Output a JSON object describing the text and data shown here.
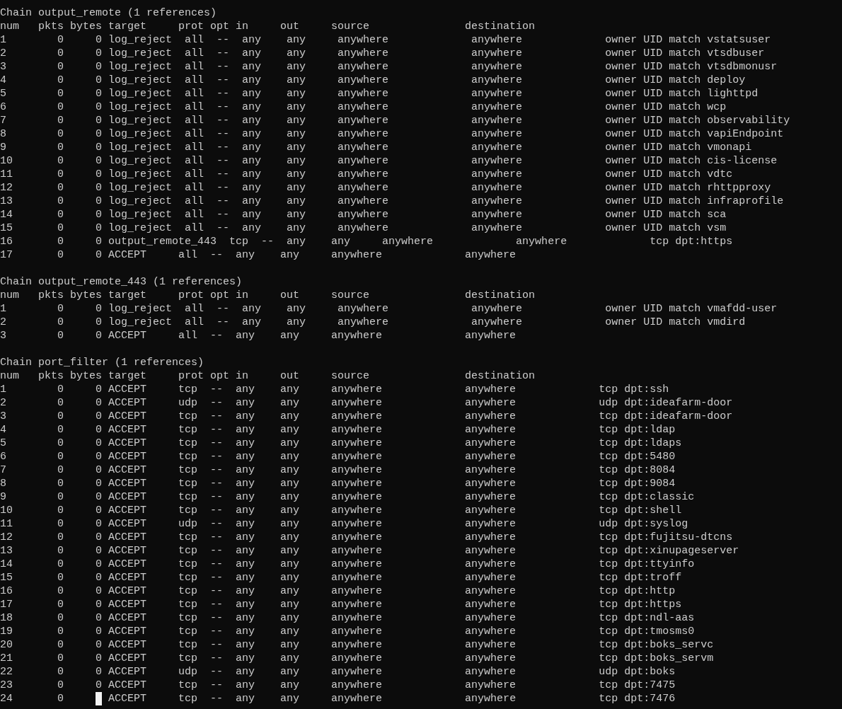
{
  "chains": [
    {
      "title": "Chain output_remote (1 references)",
      "header": "num   pkts bytes target     prot opt in     out     source               destination",
      "rows": [
        "1        0     0 log_reject  all  --  any    any     anywhere             anywhere             owner UID match vstatsuser",
        "2        0     0 log_reject  all  --  any    any     anywhere             anywhere             owner UID match vtsdbuser",
        "3        0     0 log_reject  all  --  any    any     anywhere             anywhere             owner UID match vtsdbmonusr",
        "4        0     0 log_reject  all  --  any    any     anywhere             anywhere             owner UID match deploy",
        "5        0     0 log_reject  all  --  any    any     anywhere             anywhere             owner UID match lighttpd",
        "6        0     0 log_reject  all  --  any    any     anywhere             anywhere             owner UID match wcp",
        "7        0     0 log_reject  all  --  any    any     anywhere             anywhere             owner UID match observability",
        "8        0     0 log_reject  all  --  any    any     anywhere             anywhere             owner UID match vapiEndpoint",
        "9        0     0 log_reject  all  --  any    any     anywhere             anywhere             owner UID match vmonapi",
        "10       0     0 log_reject  all  --  any    any     anywhere             anywhere             owner UID match cis-license",
        "11       0     0 log_reject  all  --  any    any     anywhere             anywhere             owner UID match vdtc",
        "12       0     0 log_reject  all  --  any    any     anywhere             anywhere             owner UID match rhttpproxy",
        "13       0     0 log_reject  all  --  any    any     anywhere             anywhere             owner UID match infraprofile",
        "14       0     0 log_reject  all  --  any    any     anywhere             anywhere             owner UID match sca",
        "15       0     0 log_reject  all  --  any    any     anywhere             anywhere             owner UID match vsm",
        "16       0     0 output_remote_443  tcp  --  any    any     anywhere             anywhere             tcp dpt:https",
        "17       0     0 ACCEPT     all  --  any    any     anywhere             anywhere"
      ]
    },
    {
      "title": "Chain output_remote_443 (1 references)",
      "header": "num   pkts bytes target     prot opt in     out     source               destination",
      "rows": [
        "1        0     0 log_reject  all  --  any    any     anywhere             anywhere             owner UID match vmafdd-user",
        "2        0     0 log_reject  all  --  any    any     anywhere             anywhere             owner UID match vmdird",
        "3        0     0 ACCEPT     all  --  any    any     anywhere             anywhere"
      ]
    },
    {
      "title": "Chain port_filter (1 references)",
      "header": "num   pkts bytes target     prot opt in     out     source               destination",
      "rows": [
        "1        0     0 ACCEPT     tcp  --  any    any     anywhere             anywhere             tcp dpt:ssh",
        "2        0     0 ACCEPT     udp  --  any    any     anywhere             anywhere             udp dpt:ideafarm-door",
        "3        0     0 ACCEPT     tcp  --  any    any     anywhere             anywhere             tcp dpt:ideafarm-door",
        "4        0     0 ACCEPT     tcp  --  any    any     anywhere             anywhere             tcp dpt:ldap",
        "5        0     0 ACCEPT     tcp  --  any    any     anywhere             anywhere             tcp dpt:ldaps",
        "6        0     0 ACCEPT     tcp  --  any    any     anywhere             anywhere             tcp dpt:5480",
        "7        0     0 ACCEPT     tcp  --  any    any     anywhere             anywhere             tcp dpt:8084",
        "8        0     0 ACCEPT     tcp  --  any    any     anywhere             anywhere             tcp dpt:9084",
        "9        0     0 ACCEPT     tcp  --  any    any     anywhere             anywhere             tcp dpt:classic",
        "10       0     0 ACCEPT     tcp  --  any    any     anywhere             anywhere             tcp dpt:shell",
        "11       0     0 ACCEPT     udp  --  any    any     anywhere             anywhere             udp dpt:syslog",
        "12       0     0 ACCEPT     tcp  --  any    any     anywhere             anywhere             tcp dpt:fujitsu-dtcns",
        "13       0     0 ACCEPT     tcp  --  any    any     anywhere             anywhere             tcp dpt:xinupageserver",
        "14       0     0 ACCEPT     tcp  --  any    any     anywhere             anywhere             tcp dpt:ttyinfo",
        "15       0     0 ACCEPT     tcp  --  any    any     anywhere             anywhere             tcp dpt:troff",
        "16       0     0 ACCEPT     tcp  --  any    any     anywhere             anywhere             tcp dpt:http",
        "17       0     0 ACCEPT     tcp  --  any    any     anywhere             anywhere             tcp dpt:https",
        "18       0     0 ACCEPT     tcp  --  any    any     anywhere             anywhere             tcp dpt:ndl-aas",
        "19       0     0 ACCEPT     tcp  --  any    any     anywhere             anywhere             tcp dpt:tmosms0",
        "20       0     0 ACCEPT     tcp  --  any    any     anywhere             anywhere             tcp dpt:boks_servc",
        "21       0     0 ACCEPT     tcp  --  any    any     anywhere             anywhere             tcp dpt:boks_servm",
        "22       0     0 ACCEPT     udp  --  any    any     anywhere             anywhere             udp dpt:boks",
        "23       0     0 ACCEPT     tcp  --  any    any     anywhere             anywhere             tcp dpt:7475"
      ],
      "cursor_line": {
        "before": "24       0     ",
        "after": " ACCEPT     tcp  --  any    any     anywhere             anywhere             tcp dpt:7476"
      }
    }
  ]
}
